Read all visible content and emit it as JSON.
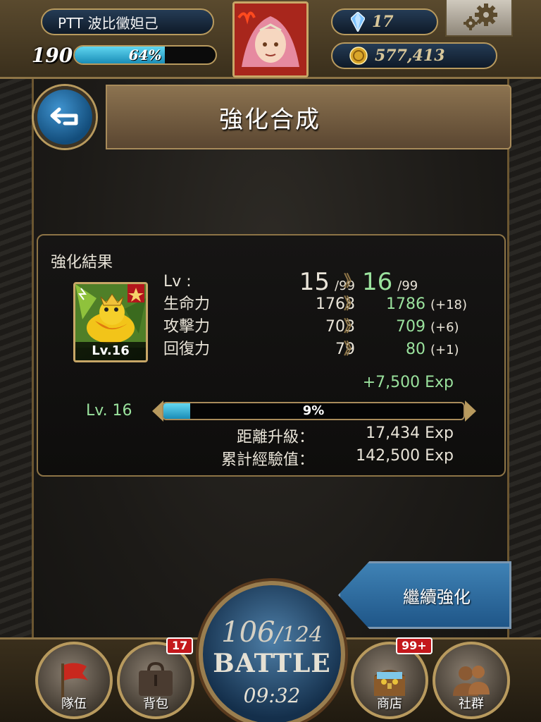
{
  "header": {
    "player_name": "PTT 波比黴妲己",
    "player_level": "190",
    "xp_percent_text": "64%",
    "xp_fraction": 0.64,
    "gems": "17",
    "coins": "577,413"
  },
  "page": {
    "title": "強化合成"
  },
  "result": {
    "section_title": "強化結果",
    "card_level": "Lv.16",
    "stats": [
      {
        "label": "Lv :",
        "old": "15",
        "old_suffix": "/99",
        "arrow": "》",
        "new": "16",
        "new_suffix": "/99",
        "bonus": ""
      },
      {
        "label": "生命力",
        "old": "1768",
        "arrow": "》",
        "new": "1786",
        "bonus": "(+18)"
      },
      {
        "label": "攻擊力",
        "old": "703",
        "arrow": "》",
        "new": "709",
        "bonus": "(+6)"
      },
      {
        "label": "回復力",
        "old": "79",
        "arrow": "》",
        "new": "80",
        "bonus": "(+1)"
      }
    ],
    "exp_gained": "+7,500 Exp",
    "exp_level_label": "Lv. 16",
    "exp_percent_text": "9%",
    "exp_fraction": 0.09,
    "to_next_label": "距離升級：",
    "to_next_value": "17,434 Exp",
    "total_label": "累計經驗值：",
    "total_value": "142,500 Exp"
  },
  "actions": {
    "continue_label": "繼續強化"
  },
  "nav": {
    "team_label": "隊伍",
    "bag_label": "背包",
    "bag_badge": "17",
    "shop_label": "商店",
    "shop_badge": "99+",
    "social_label": "社群",
    "battle_current": "106",
    "battle_max": "/124",
    "battle_word": "BATTLE",
    "battle_timer": "09:32"
  },
  "colors": {
    "accent_gold": "#b89a5e",
    "exp_green": "#9ae29d",
    "bar_blue": "#1a8db7",
    "badge_red": "#c4181c"
  }
}
